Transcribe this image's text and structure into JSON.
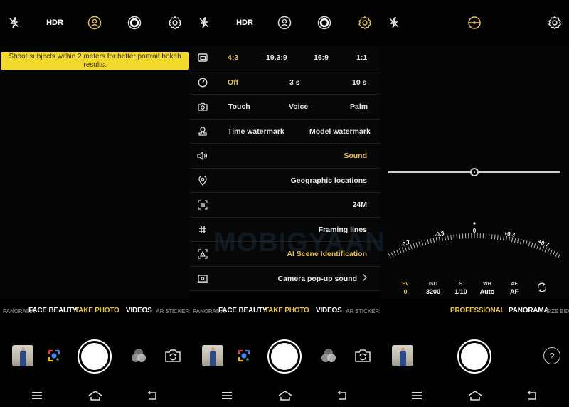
{
  "theme": {
    "accent": "#e2c14c",
    "tip_bg": "#f3d92b",
    "background": "#000000"
  },
  "panel_portrait": {
    "topbar": {
      "icons": [
        "flash-off-icon",
        "hdr",
        "portrait-icon",
        "live-photo-icon",
        "gear-icon"
      ],
      "hdr_label": "HDR",
      "active_icon": "portrait-icon"
    },
    "tip_text": "Shoot subjects within 2 meters for better portrait bokeh results.",
    "modes": [
      "PANORAMA",
      "FACE BEAUTY",
      "TAKE PHOTO",
      "VIDEOS",
      "AR STICKERS"
    ],
    "active_mode": "TAKE PHOTO",
    "bottom_icons": [
      "gallery-thumbnail",
      "google-lens-icon",
      "shutter-button",
      "filter-icon",
      "switch-camera-icon"
    ]
  },
  "panel_settings": {
    "topbar": {
      "icons": [
        "flash-off-icon",
        "hdr",
        "portrait-icon",
        "live-photo-icon",
        "gear-icon"
      ],
      "hdr_label": "HDR",
      "active_icon": "gear-icon"
    },
    "rows": [
      {
        "icon": "aspect-ratio-icon",
        "options": [
          "4:3",
          "19.3:9",
          "16:9",
          "1:1"
        ],
        "selected": "4:3"
      },
      {
        "icon": "timer-icon",
        "options": [
          "Off",
          "3 s",
          "10 s"
        ],
        "selected": "Off"
      },
      {
        "icon": "camera-icon",
        "options": [
          "Touch",
          "Voice",
          "Palm"
        ],
        "selected": ""
      },
      {
        "icon": "watermark-stamp-icon",
        "options": [
          "Time watermark",
          "Model watermark"
        ],
        "selected": ""
      },
      {
        "icon": "speaker-icon",
        "options": [
          "Sound"
        ],
        "selected": "Sound"
      },
      {
        "icon": "location-pin-icon",
        "options": [
          "Geographic locations"
        ],
        "selected": ""
      },
      {
        "icon": "resolution-icon",
        "options": [
          "24M"
        ],
        "selected": ""
      },
      {
        "icon": "grid-icon",
        "options": [
          "Framing lines"
        ],
        "selected": ""
      },
      {
        "icon": "ai-scene-icon",
        "options": [
          "AI Scene Identification"
        ],
        "selected": "AI Scene Identification"
      },
      {
        "icon": "popup-camera-icon",
        "options": [
          "Camera pop-up sound"
        ],
        "selected": "",
        "chevron": true
      }
    ],
    "watermark": "MOBIGYAAN",
    "modes": [
      "PANORAMA",
      "FACE BEAUTY",
      "TAKE PHOTO",
      "VIDEOS",
      "AR STICKERS"
    ],
    "active_mode": "TAKE PHOTO"
  },
  "panel_pro": {
    "topbar": {
      "icons": [
        "flash-off-icon",
        "level-icon",
        "gear-icon"
      ],
      "active_icon": "level-icon"
    },
    "level_slider_value": 0.5,
    "ev_dial": {
      "labels": [
        "-0.7",
        "-0.3",
        "0",
        "+0.3",
        "+0.7"
      ],
      "current": "0"
    },
    "params": [
      {
        "label": "EV",
        "value": "0",
        "active": true
      },
      {
        "label": "ISO",
        "value": "3200"
      },
      {
        "label": "S",
        "value": "1/10"
      },
      {
        "label": "WB",
        "value": "Auto"
      },
      {
        "label": "AF",
        "value": "AF"
      }
    ],
    "modes": [
      "PROFESSIONAL",
      "PANORAMA",
      "SIZE BEAUTY"
    ],
    "active_mode": "PROFESSIONAL",
    "help_label": "?"
  },
  "navbar": {
    "icons": [
      "menu-icon",
      "home-icon",
      "back-icon"
    ]
  }
}
